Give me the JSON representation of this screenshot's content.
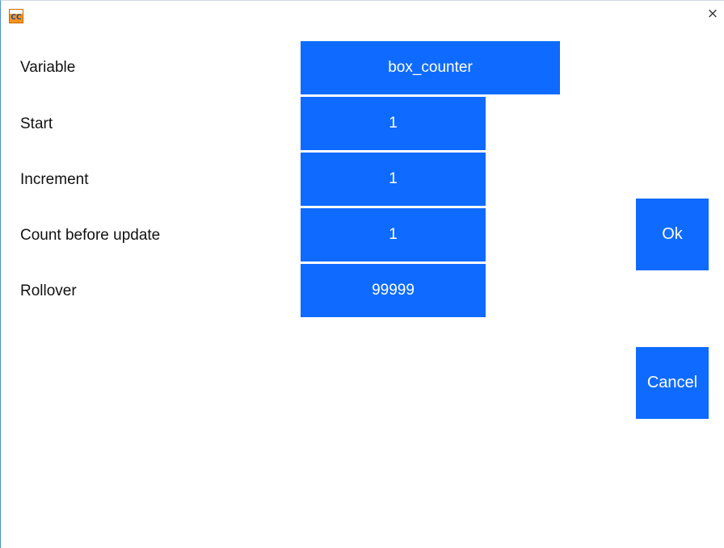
{
  "window": {
    "app_icon_text": "CC",
    "close_glyph": "×"
  },
  "form": {
    "rows": [
      {
        "label": "Variable",
        "value": "box_counter"
      },
      {
        "label": "Start",
        "value": "1"
      },
      {
        "label": "Increment",
        "value": "1"
      },
      {
        "label": "Count before update",
        "value": "1"
      },
      {
        "label": "Rollover",
        "value": "99999"
      }
    ]
  },
  "buttons": {
    "ok": "Ok",
    "cancel": "Cancel"
  },
  "colors": {
    "accent": "#0f6bff",
    "text": "#111111",
    "background": "#ffffff"
  }
}
